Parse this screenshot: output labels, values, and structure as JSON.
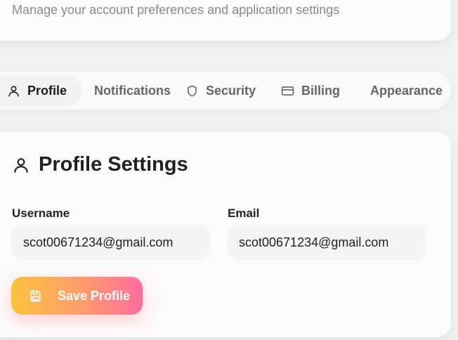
{
  "header": {
    "subtitle": "Manage your account preferences and application settings"
  },
  "tabs": [
    {
      "label": "Profile",
      "icon": "user-icon",
      "active": true
    },
    {
      "label": "Notifications",
      "icon": "bell-icon",
      "active": false
    },
    {
      "label": "Security",
      "icon": "shield-icon",
      "active": false
    },
    {
      "label": "Billing",
      "icon": "credit-card-icon",
      "active": false
    },
    {
      "label": "Appearance",
      "icon": "palette-icon",
      "active": false
    }
  ],
  "profile": {
    "title": "Profile Settings",
    "title_icon": "user-icon",
    "username_label": "Username",
    "username_value": "scot00671234@gmail.com",
    "email_label": "Email",
    "email_value": "scot00671234@gmail.com",
    "save_label": "Save Profile",
    "save_icon": "save-icon"
  },
  "colors": {
    "background": "#f2f0f0",
    "card": "#fcfbfa",
    "text": "#222222",
    "muted_text": "#8a8a8a",
    "button_gradient_start": "#ffc23d",
    "button_gradient_end": "#ff6d9b"
  }
}
